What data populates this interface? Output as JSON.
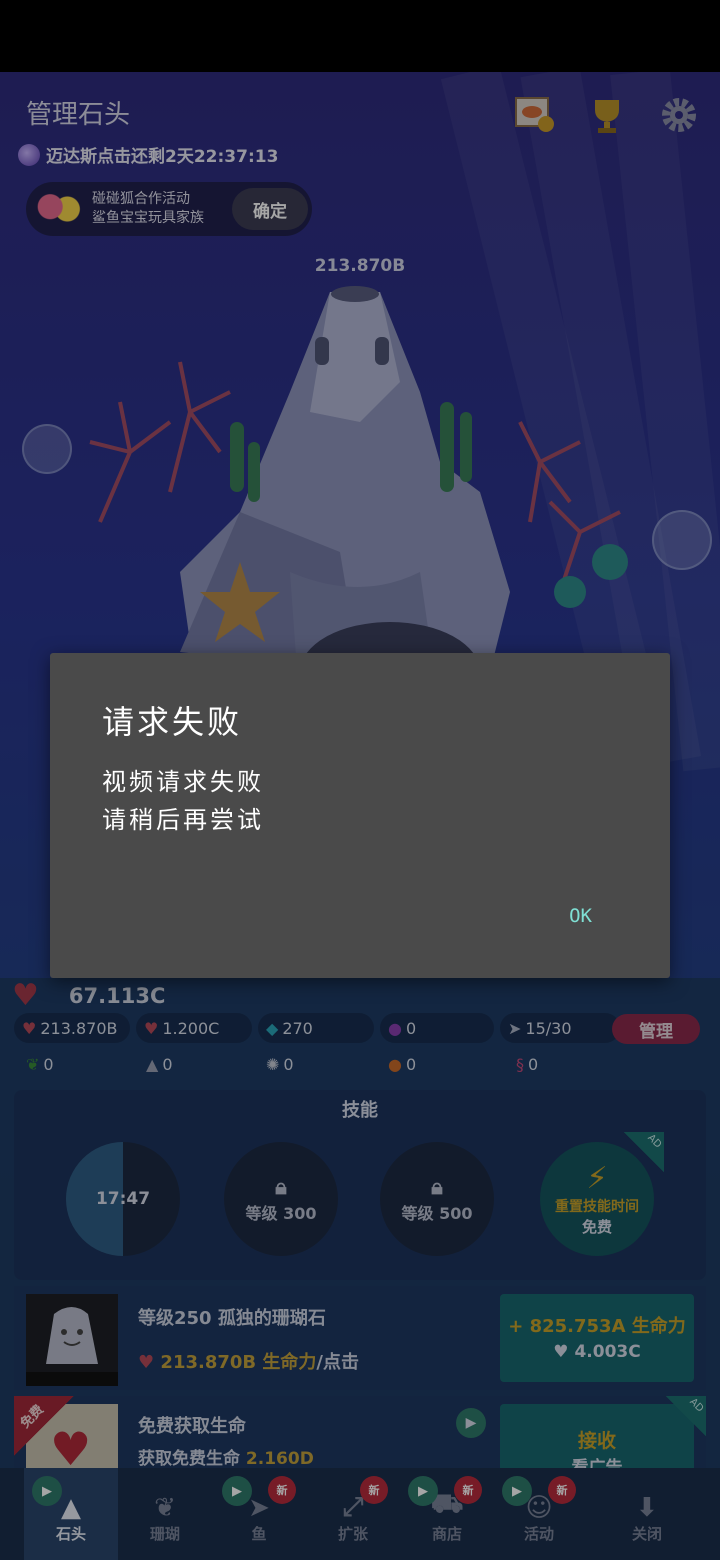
{
  "header": {
    "title": "管理石头",
    "timer_text": "迈达斯点击还剩2天22:37:13",
    "event_line1": "碰碰狐合作活动",
    "event_line2": "鲨鱼宝宝玩具家族",
    "event_confirm": "确定",
    "rock_value": "213.870B"
  },
  "dialog": {
    "title": "请求失败",
    "message_line1": "视频请求失败",
    "message_line2": "请稍后再尝试",
    "ok_label": "OK"
  },
  "stats": {
    "life": "67.113C",
    "per_tap": "213.870B",
    "per_second": "1.200C",
    "gems": "270",
    "pearls": "0",
    "fish": "15/30",
    "manage_label": "管理",
    "seaweed": "0",
    "rocks": "0",
    "urchin": "0",
    "clownfish": "0",
    "seahorse": "0"
  },
  "skills": {
    "title": "技能",
    "items": [
      {
        "label": "17:47"
      },
      {
        "label": "等级 300"
      },
      {
        "label": "等级 500"
      },
      {
        "line1": "重置技能时间",
        "line2": "免费",
        "ad": "AD"
      }
    ]
  },
  "upgrade": {
    "title": "等级250 孤独的珊瑚石",
    "value": "213.870B 生命力",
    "suffix": "/点击",
    "btn_top": "+ 825.753A 生命力",
    "btn_bottom": "4.003C"
  },
  "free_life": {
    "ribbon": "免费",
    "title": "免费获取生命",
    "sub_prefix": "获取免费生命 ",
    "sub_value": "2.160D",
    "btn_line1": "接收",
    "btn_line2": "看广告",
    "ad": "AD"
  },
  "tabs": [
    {
      "label": "石头",
      "new": ""
    },
    {
      "label": "珊瑚",
      "new": ""
    },
    {
      "label": "鱼",
      "new": "新"
    },
    {
      "label": "扩张",
      "new": "新"
    },
    {
      "label": "商店",
      "new": "新"
    },
    {
      "label": "活动",
      "new": "新"
    },
    {
      "label": "关闭",
      "new": ""
    }
  ],
  "colors": {
    "dialog_bg": "#4a4a4a",
    "ok_text": "#7fe0d4",
    "manage_btn": "#8a2a4c",
    "gold_text": "#c4a13c"
  }
}
